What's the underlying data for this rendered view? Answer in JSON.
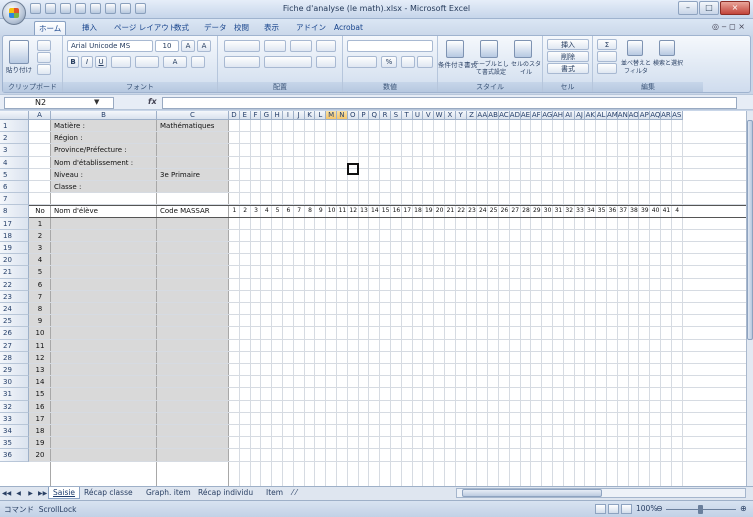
{
  "window": {
    "title": "Fiche d'analyse (le math).xlsx - Microsoft Excel",
    "min_glyph": "–",
    "max_glyph": "□",
    "close_glyph": "×"
  },
  "ribbon_tabs": [
    "ホーム",
    "挿入",
    "ページ レイアウト",
    "数式",
    "データ",
    "校閲",
    "表示",
    "アドイン",
    "Acrobat"
  ],
  "ribbon_right": "◎ ‒ ◻ ×",
  "clipboard": {
    "paste": "貼り付け",
    "label": "クリップボード"
  },
  "font": {
    "name": "Arial Unicode MS",
    "size": "10",
    "label": "フォント",
    "bold": "B",
    "italic": "I",
    "underline": "U"
  },
  "alignment": {
    "label": "配置"
  },
  "number": {
    "label": "数値"
  },
  "styles": {
    "label": "スタイル",
    "cond": "条件付き書式",
    "table": "テーブルとして書式設定",
    "cell": "セルのスタイル"
  },
  "cells": {
    "label": "セル",
    "insert": "挿入",
    "delete": "削除",
    "format": "書式"
  },
  "editing": {
    "label": "編集",
    "sort": "並べ替えとフィルタ",
    "find": "検索と選択",
    "sigma": "Σ"
  },
  "formula_bar": {
    "namebox": "N2",
    "fx": "fx",
    "value": ""
  },
  "columns": {
    "A": "A",
    "B": "B",
    "C": "C",
    "rest": [
      "D",
      "E",
      "F",
      "G",
      "H",
      "I",
      "J",
      "K",
      "L",
      "M",
      "N",
      "O",
      "P",
      "Q",
      "R",
      "S",
      "T",
      "U",
      "V",
      "W",
      "X",
      "Y",
      "Z",
      "AA",
      "AB",
      "AC",
      "AD",
      "AE",
      "AF",
      "AG",
      "AH",
      "AI",
      "AJ",
      "AK",
      "AL",
      "AM",
      "AN",
      "AO",
      "AP",
      "AQ",
      "AR",
      "AS"
    ]
  },
  "header_rows": [
    {
      "row": "1",
      "label": "Matière :",
      "value": "Mathématiques"
    },
    {
      "row": "2",
      "label": "Région :",
      "value": ""
    },
    {
      "row": "3",
      "label": "Province/Préfecture :",
      "value": ""
    },
    {
      "row": "4",
      "label": "Nom d'établissement :",
      "value": ""
    },
    {
      "row": "5",
      "label": "Niveau :",
      "value": "3e Primaire"
    },
    {
      "row": "6",
      "label": "Classe :",
      "value": ""
    },
    {
      "row": "7",
      "label": "",
      "value": ""
    }
  ],
  "table_header": {
    "row": "8",
    "no": "No",
    "name": "Nom d'élève",
    "code": "Code MASSAR",
    "nums": [
      "1",
      "2",
      "3",
      "4",
      "5",
      "6",
      "7",
      "8",
      "9",
      "10",
      "11",
      "12",
      "13",
      "14",
      "15",
      "16",
      "17",
      "18",
      "19",
      "20",
      "21",
      "22",
      "23",
      "24",
      "25",
      "26",
      "27",
      "28",
      "29",
      "30",
      "31",
      "32",
      "33",
      "34",
      "35",
      "36",
      "37",
      "38",
      "39",
      "40",
      "41",
      "4"
    ]
  },
  "student_rows": [
    {
      "row": "17",
      "no": "1"
    },
    {
      "row": "18",
      "no": "2"
    },
    {
      "row": "19",
      "no": "3"
    },
    {
      "row": "20",
      "no": "4"
    },
    {
      "row": "21",
      "no": "5"
    },
    {
      "row": "22",
      "no": "6"
    },
    {
      "row": "23",
      "no": "7"
    },
    {
      "row": "24",
      "no": "8"
    },
    {
      "row": "25",
      "no": "9"
    },
    {
      "row": "26",
      "no": "10"
    },
    {
      "row": "27",
      "no": "11"
    },
    {
      "row": "28",
      "no": "12"
    },
    {
      "row": "29",
      "no": "13"
    },
    {
      "row": "30",
      "no": "14"
    },
    {
      "row": "31",
      "no": "15"
    },
    {
      "row": "32",
      "no": "16"
    },
    {
      "row": "33",
      "no": "17"
    },
    {
      "row": "34",
      "no": "18"
    },
    {
      "row": "35",
      "no": "19"
    },
    {
      "row": "36",
      "no": "20"
    }
  ],
  "sheet_tabs": [
    "Saisie",
    "Récap classe",
    "Graph. item",
    "Récap individu",
    "Item",
    "⁄ ⁄"
  ],
  "active_sheet": 0,
  "status": {
    "mode": "コマンド",
    "scroll_lock": "ScrollLock",
    "zoom": "100%"
  },
  "colors": {
    "accent": "#15428b",
    "grid_fill": "#d9d9d9",
    "ribbon": "#dbe5f2"
  }
}
